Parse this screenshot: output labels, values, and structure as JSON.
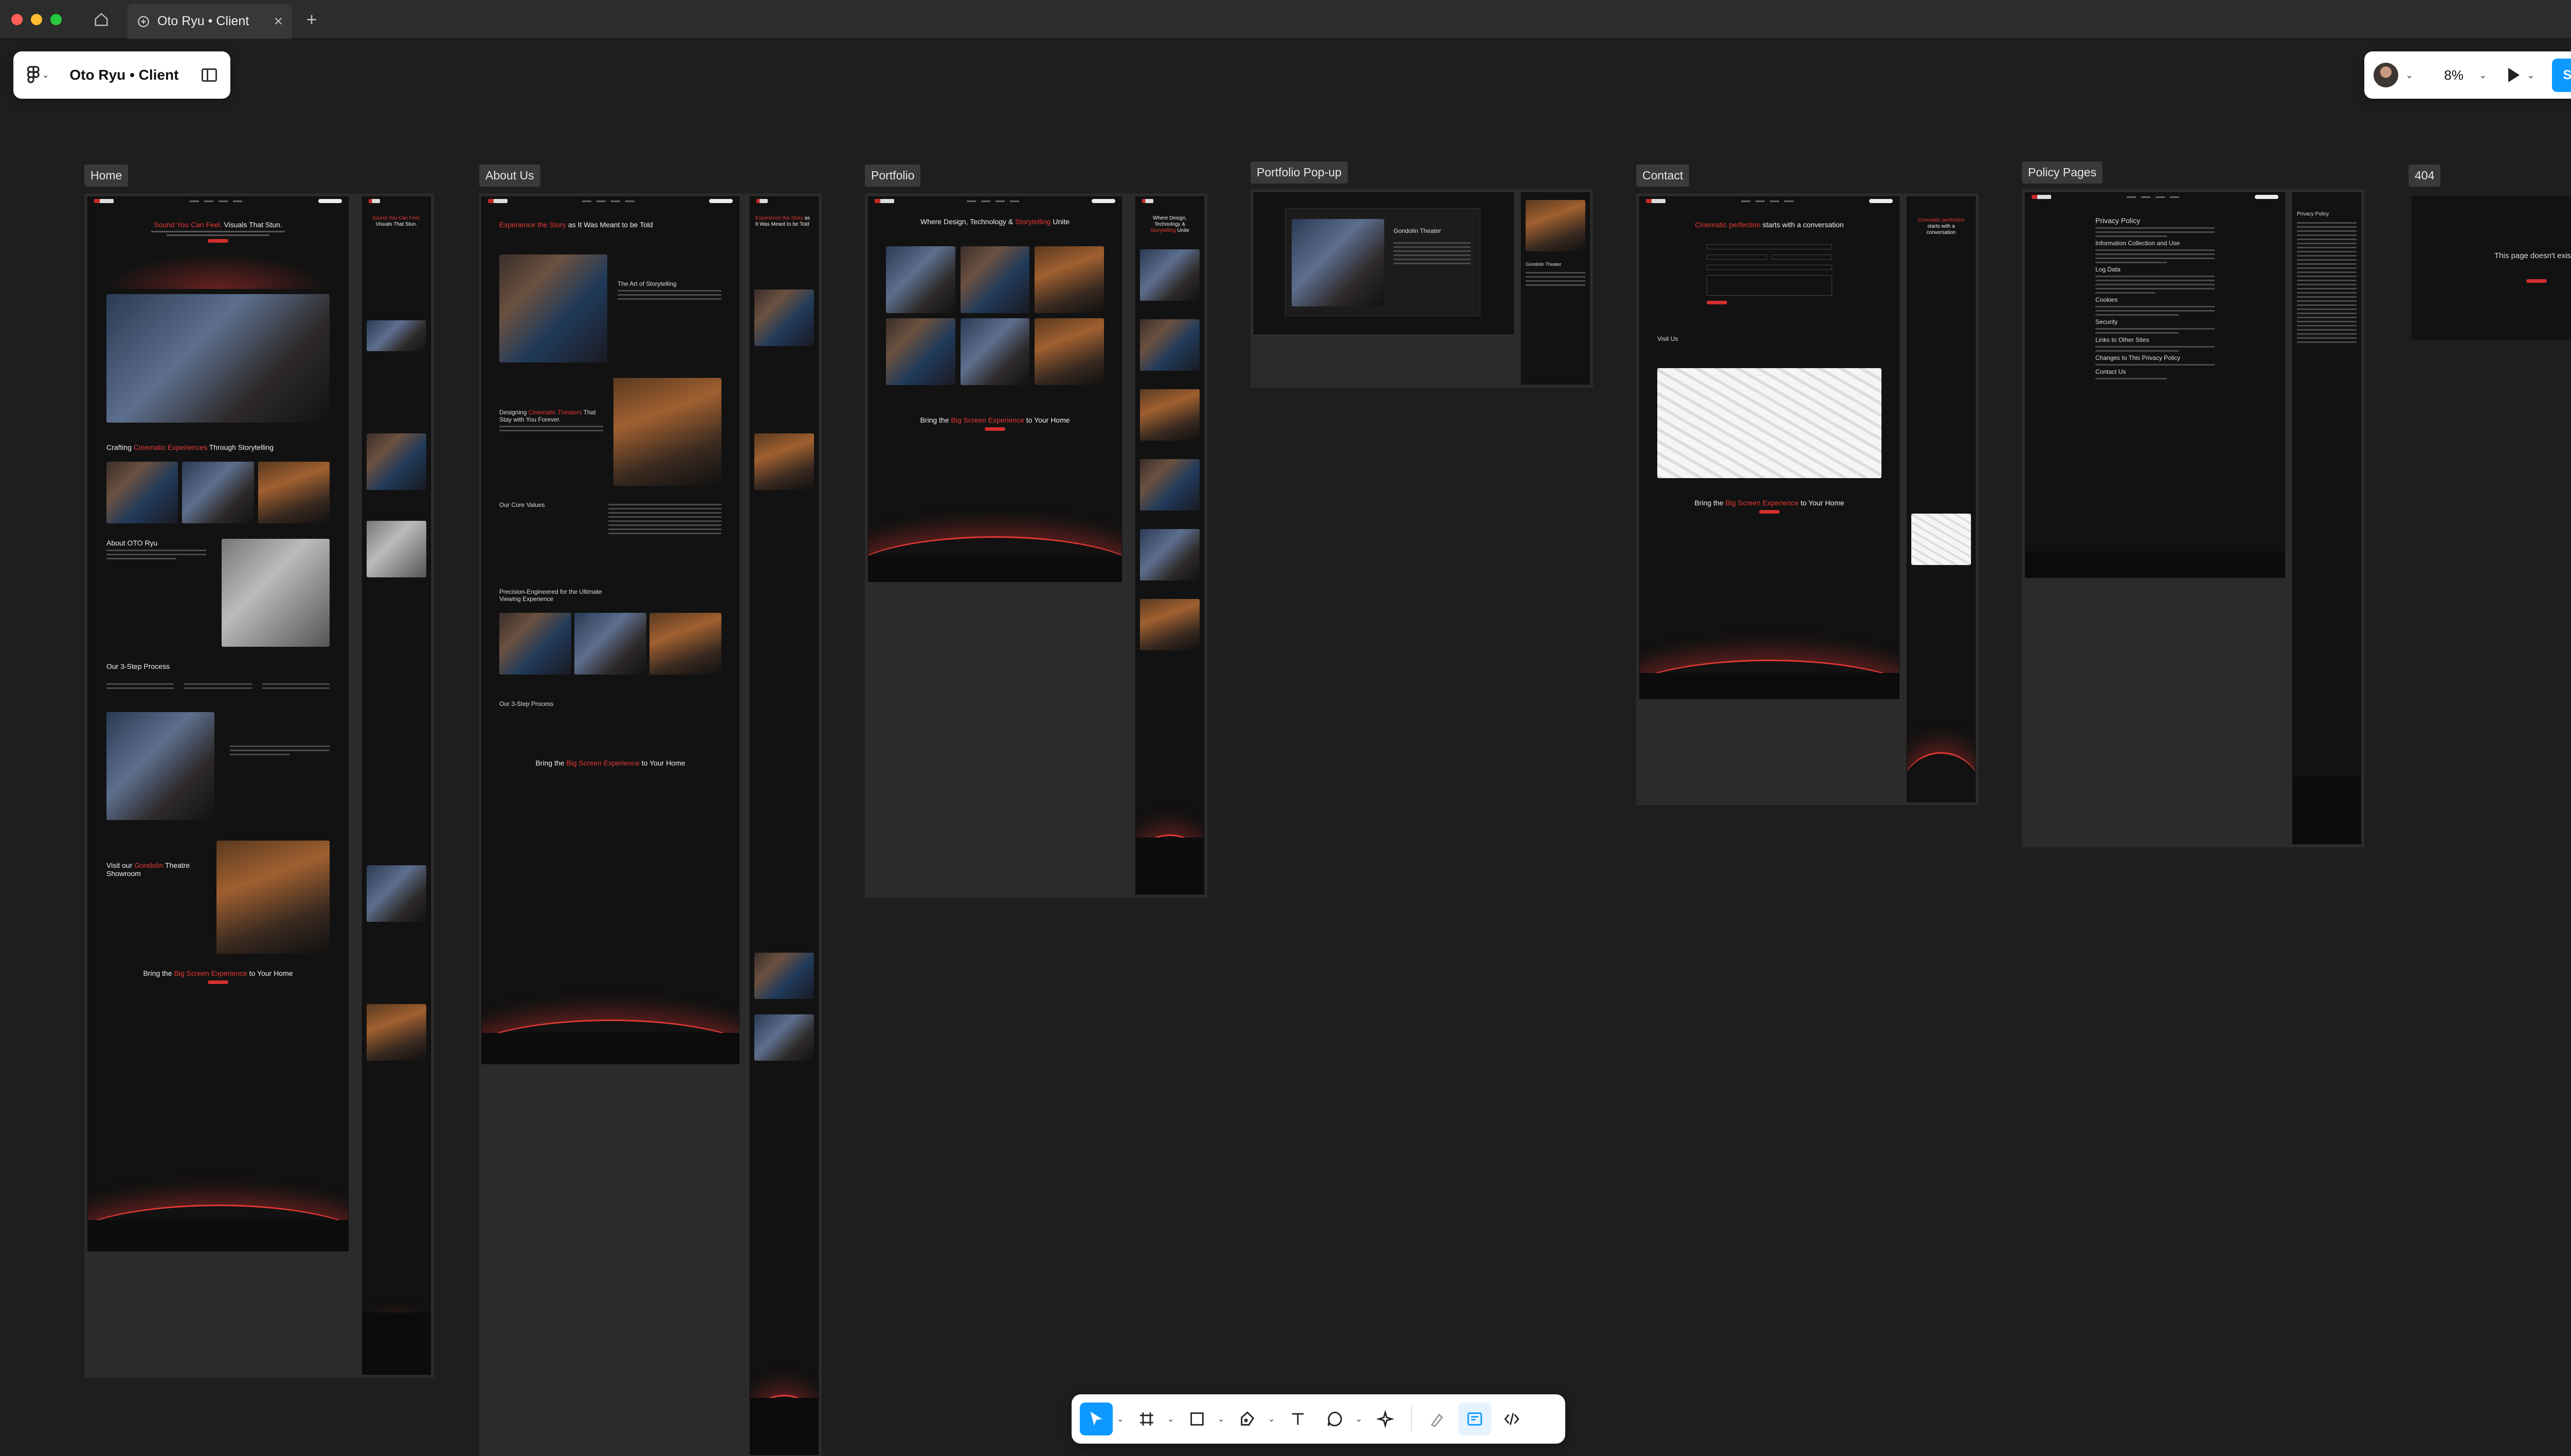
{
  "window": {
    "tab_title": "Oto Ryu • Client"
  },
  "file_toolbar": {
    "file_name": "Oto Ryu • Client"
  },
  "right_toolbar": {
    "zoom": "8%",
    "share_label": "Share"
  },
  "frames": {
    "home": "Home",
    "about": "About Us",
    "portfolio": "Portfolio",
    "popup": "Portfolio Pop-up",
    "contact": "Contact",
    "policy": "Policy Pages",
    "notfound": "404"
  },
  "page_text": {
    "home_hero_1": "Sound You Can Feel.",
    "home_hero_2": " Visuals That Stun.",
    "home_crafting_1": "Crafting ",
    "home_crafting_2": "Cinematic Experiences",
    "home_crafting_3": " Through Storytelling",
    "home_about": "About OTO Ryu",
    "home_steps": "Our 3-Step Process",
    "home_visit_1": "Visit our ",
    "home_visit_2": "Gondolin",
    "home_visit_3": " Theatre Showroom",
    "cta_1": "Bring the ",
    "cta_2": "Big Screen Experience",
    "cta_3": " to Your Home",
    "about_hero_1": "Experience the Story",
    "about_hero_2": " as It Was Meant to be Told",
    "about_art": "The Art of Storytelling",
    "about_designing_1": "Designing ",
    "about_designing_2": "Cinematic Theaters",
    "about_designing_3": " That Stay with You Forever.",
    "about_values": "Our Core Values",
    "about_precision": "Precision-Engineered for the Ultimate Viewing Experience",
    "portfolio_hero_1": "Where Design, Technology & ",
    "portfolio_hero_2": "Storytelling",
    "portfolio_hero_3": " Unite",
    "popup_title": "Gondolin Theater",
    "contact_hero_1": "Cinematic perfection",
    "contact_hero_2": " starts with a conversation",
    "contact_visit": "Visit Us",
    "policy_title": "Privacy Policy",
    "policy_h1": "Information Collection and Use",
    "policy_h2": "Log Data",
    "policy_h3": "Cookies",
    "policy_h4": "Security",
    "policy_h5": "Links to Other Sites",
    "policy_h6": "Changes to This Privacy Policy",
    "policy_h7": "Contact Us",
    "notfound_title": "This page doesn't exist"
  },
  "theme": {
    "canvas_bg": "#1e1e1e",
    "accent": "#e53935",
    "figma_blue": "#0d99ff"
  }
}
